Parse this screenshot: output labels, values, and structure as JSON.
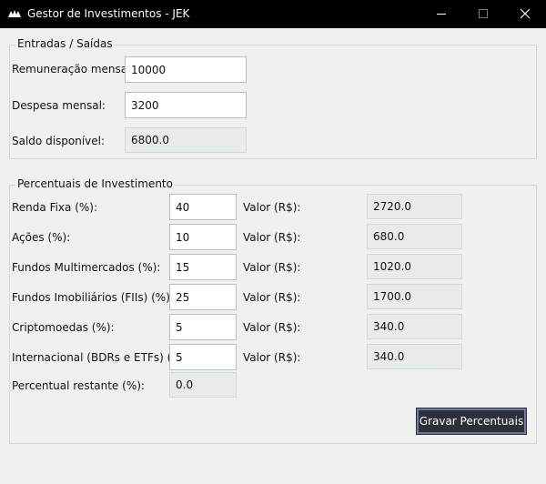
{
  "window": {
    "title": "Gestor de Investimentos - JEK"
  },
  "icons": {
    "app": "app-logo-icon",
    "minimize": "minimize-icon",
    "maximize": "maximize-icon",
    "close": "close-icon"
  },
  "entradas": {
    "legend": "Entradas / Saídas",
    "remuneracao_label": "Remuneração mensal:",
    "remuneracao_value": "10000",
    "despesa_label": "Despesa mensal:",
    "despesa_value": "3200",
    "saldo_label": "Saldo disponível:",
    "saldo_value": "6800.0"
  },
  "percentuais": {
    "legend": "Percentuais de Investimento",
    "valor_label": "Valor (R$):",
    "rows": [
      {
        "label": "Renda Fixa (%):",
        "percent": "40",
        "valor": "2720.0"
      },
      {
        "label": "Ações (%):",
        "percent": "10",
        "valor": "680.0"
      },
      {
        "label": "Fundos Multimercados (%):",
        "percent": "15",
        "valor": "1020.0"
      },
      {
        "label": "Fundos Imobiliários (FIIs) (%):",
        "percent": "25",
        "valor": "1700.0"
      },
      {
        "label": "Criptomoedas (%):",
        "percent": "5",
        "valor": "340.0"
      },
      {
        "label": "Internacional (BDRs e ETFs) (%):",
        "percent": "5",
        "valor": "340.0"
      }
    ],
    "restante_label": "Percentual restante (%):",
    "restante_value": "0.0",
    "gravar_label": "Gravar Percentuais"
  }
}
